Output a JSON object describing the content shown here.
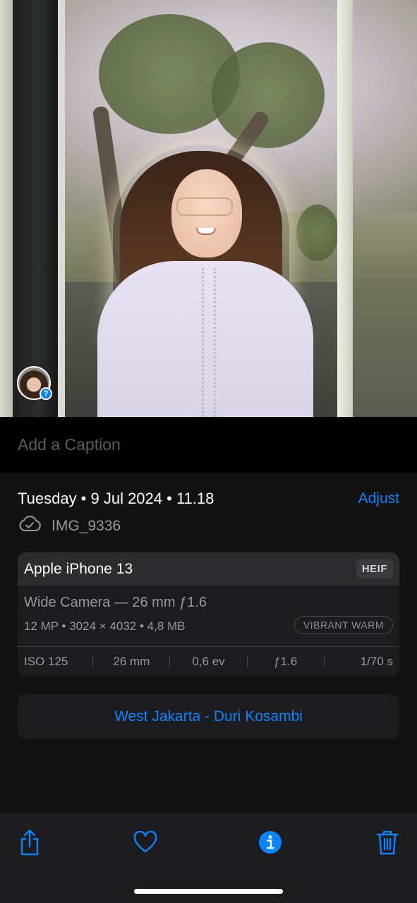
{
  "photo": {
    "people_badge_symbol": "?"
  },
  "caption": {
    "placeholder": "Add a Caption"
  },
  "info": {
    "date": "Tuesday • 9 Jul 2024 • 11.18",
    "adjust_label": "Adjust",
    "filename": "IMG_9336",
    "cloud_icon": "cloud-check-icon"
  },
  "camera": {
    "device": "Apple iPhone 13",
    "format": "HEIF",
    "lens": "Wide Camera — 26 mm ƒ1.6",
    "specs": "12 MP • 3024 × 4032 • 4,8 MB",
    "style_tag": "VIBRANT WARM",
    "exif": {
      "iso": "ISO 125",
      "focal": "26 mm",
      "ev": "0,6 ev",
      "aperture": "ƒ1.6",
      "shutter": "1/70 s"
    }
  },
  "location": {
    "label": "West Jakarta - Duri Kosambi"
  },
  "toolbar": {
    "share_icon": "share-icon",
    "favorite_icon": "heart-icon",
    "info_icon": "info-icon",
    "delete_icon": "trash-icon"
  },
  "colors": {
    "accent": "#0a84ff",
    "background": "#121212",
    "card": "#1c1c1e",
    "secondary_text": "#98989d"
  }
}
